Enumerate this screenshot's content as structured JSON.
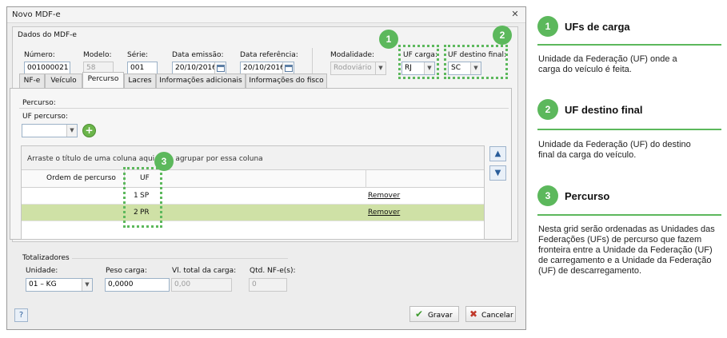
{
  "window": {
    "title": "Novo MDF-e",
    "close_icon": "close-icon"
  },
  "dados": {
    "legend": "Dados do MDF-e",
    "numero": {
      "label": "Número:",
      "value": "001000021"
    },
    "modelo": {
      "label": "Modelo:",
      "value": "58"
    },
    "serie": {
      "label": "Série:",
      "value": "001"
    },
    "data_emissao": {
      "label": "Data emissão:",
      "value": "20/10/2016"
    },
    "data_referencia": {
      "label": "Data referência:",
      "value": "20/10/2016"
    },
    "modalidade": {
      "label": "Modalidade:",
      "value": "Rodoviário"
    },
    "uf_carga": {
      "label": "UF carga:",
      "value": "RJ"
    },
    "uf_destino": {
      "label": "UF destino final:",
      "value": "SC"
    }
  },
  "tabs": [
    {
      "label": "NF-e"
    },
    {
      "label": "Veículo"
    },
    {
      "label": "Percurso"
    },
    {
      "label": "Lacres"
    },
    {
      "label": "Informações adicionais"
    },
    {
      "label": "Informações do fisco"
    }
  ],
  "percurso": {
    "legend": "Percurso:",
    "uf_percurso_label": "UF percurso:",
    "uf_percurso_value": "",
    "grid": {
      "group_hint": "Arraste o título de uma coluna aqui para agrupar por essa coluna",
      "columns": [
        "Ordem de percurso",
        "UF",
        ""
      ],
      "rows": [
        {
          "ordem": "1",
          "uf": "SP",
          "action": "Remover"
        },
        {
          "ordem": "2",
          "uf": "PR",
          "action": "Remover"
        }
      ]
    }
  },
  "totalizadores": {
    "legend": "Totalizadores",
    "unidade": {
      "label": "Unidade:",
      "value": "01 – KG"
    },
    "peso": {
      "label": "Peso carga:",
      "value": "0,0000"
    },
    "valor": {
      "label": "Vl. total da carga:",
      "value": "0,00"
    },
    "qtd": {
      "label": "Qtd. NF-e(s):",
      "value": "0"
    }
  },
  "footer": {
    "help": "?",
    "gravar": "Gravar",
    "cancelar": "Cancelar"
  },
  "callouts": [
    "1",
    "2",
    "3"
  ],
  "legend": [
    {
      "number": "1",
      "title": "UFs de carga",
      "text": "Unidade da Federação (UF) onde a carga do veículo é feita."
    },
    {
      "number": "2",
      "title": "UF destino final",
      "text": "Unidade da Federação (UF) do destino final da carga do veículo."
    },
    {
      "number": "3",
      "title": "Percurso",
      "text": "Nesta grid serão ordenadas as Unidades das Federações (UFs) de percurso que fazem fronteira entre a Unidade da Federação (UF) de carregamento e a Unidade da Federação (UF) de descarregamento."
    }
  ],
  "colors": {
    "accent": "#5cb85c",
    "selected_row": "#cfe1a6"
  }
}
